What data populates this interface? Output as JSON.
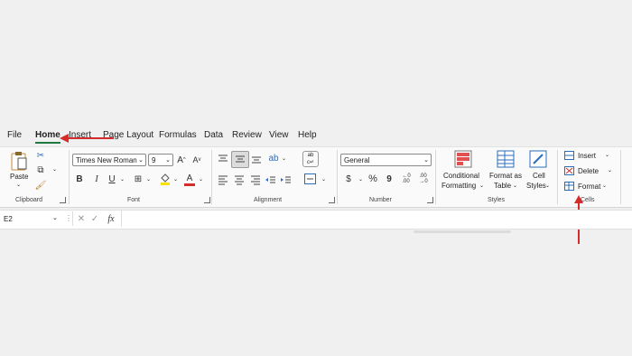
{
  "tabs": [
    "File",
    "Home",
    "Insert",
    "Page Layout",
    "Formulas",
    "Data",
    "Review",
    "View",
    "Help"
  ],
  "clipboard": {
    "paste_label": "Paste",
    "group_label": "Clipboard"
  },
  "font": {
    "name": "Times New Roman",
    "size": "9",
    "bold": "B",
    "italic": "I",
    "underline": "U",
    "font_color_letter": "A",
    "group_label": "Font"
  },
  "alignment": {
    "group_label": "Alignment"
  },
  "number": {
    "format": "General",
    "currency": "$",
    "percent": "%",
    "comma": "9",
    "inc_dec": ".00",
    "group_label": "Number"
  },
  "styles": {
    "conditional": "Conditional",
    "formatting": "Formatting",
    "format_as": "Format as",
    "table": "Table",
    "cell": "Cell",
    "cell_styles": "Styles",
    "group_label": "Styles"
  },
  "cells": {
    "insert": "Insert",
    "delete": "Delete",
    "format": "Format",
    "group_label": "Cells"
  },
  "formula_bar": {
    "name_box": "E2",
    "fx": "fx",
    "formula": ""
  },
  "accent_colors": {
    "arrow": "#d62b2b",
    "home_underline": "#1e7a3e",
    "fill_highlight": "#f6e100"
  }
}
